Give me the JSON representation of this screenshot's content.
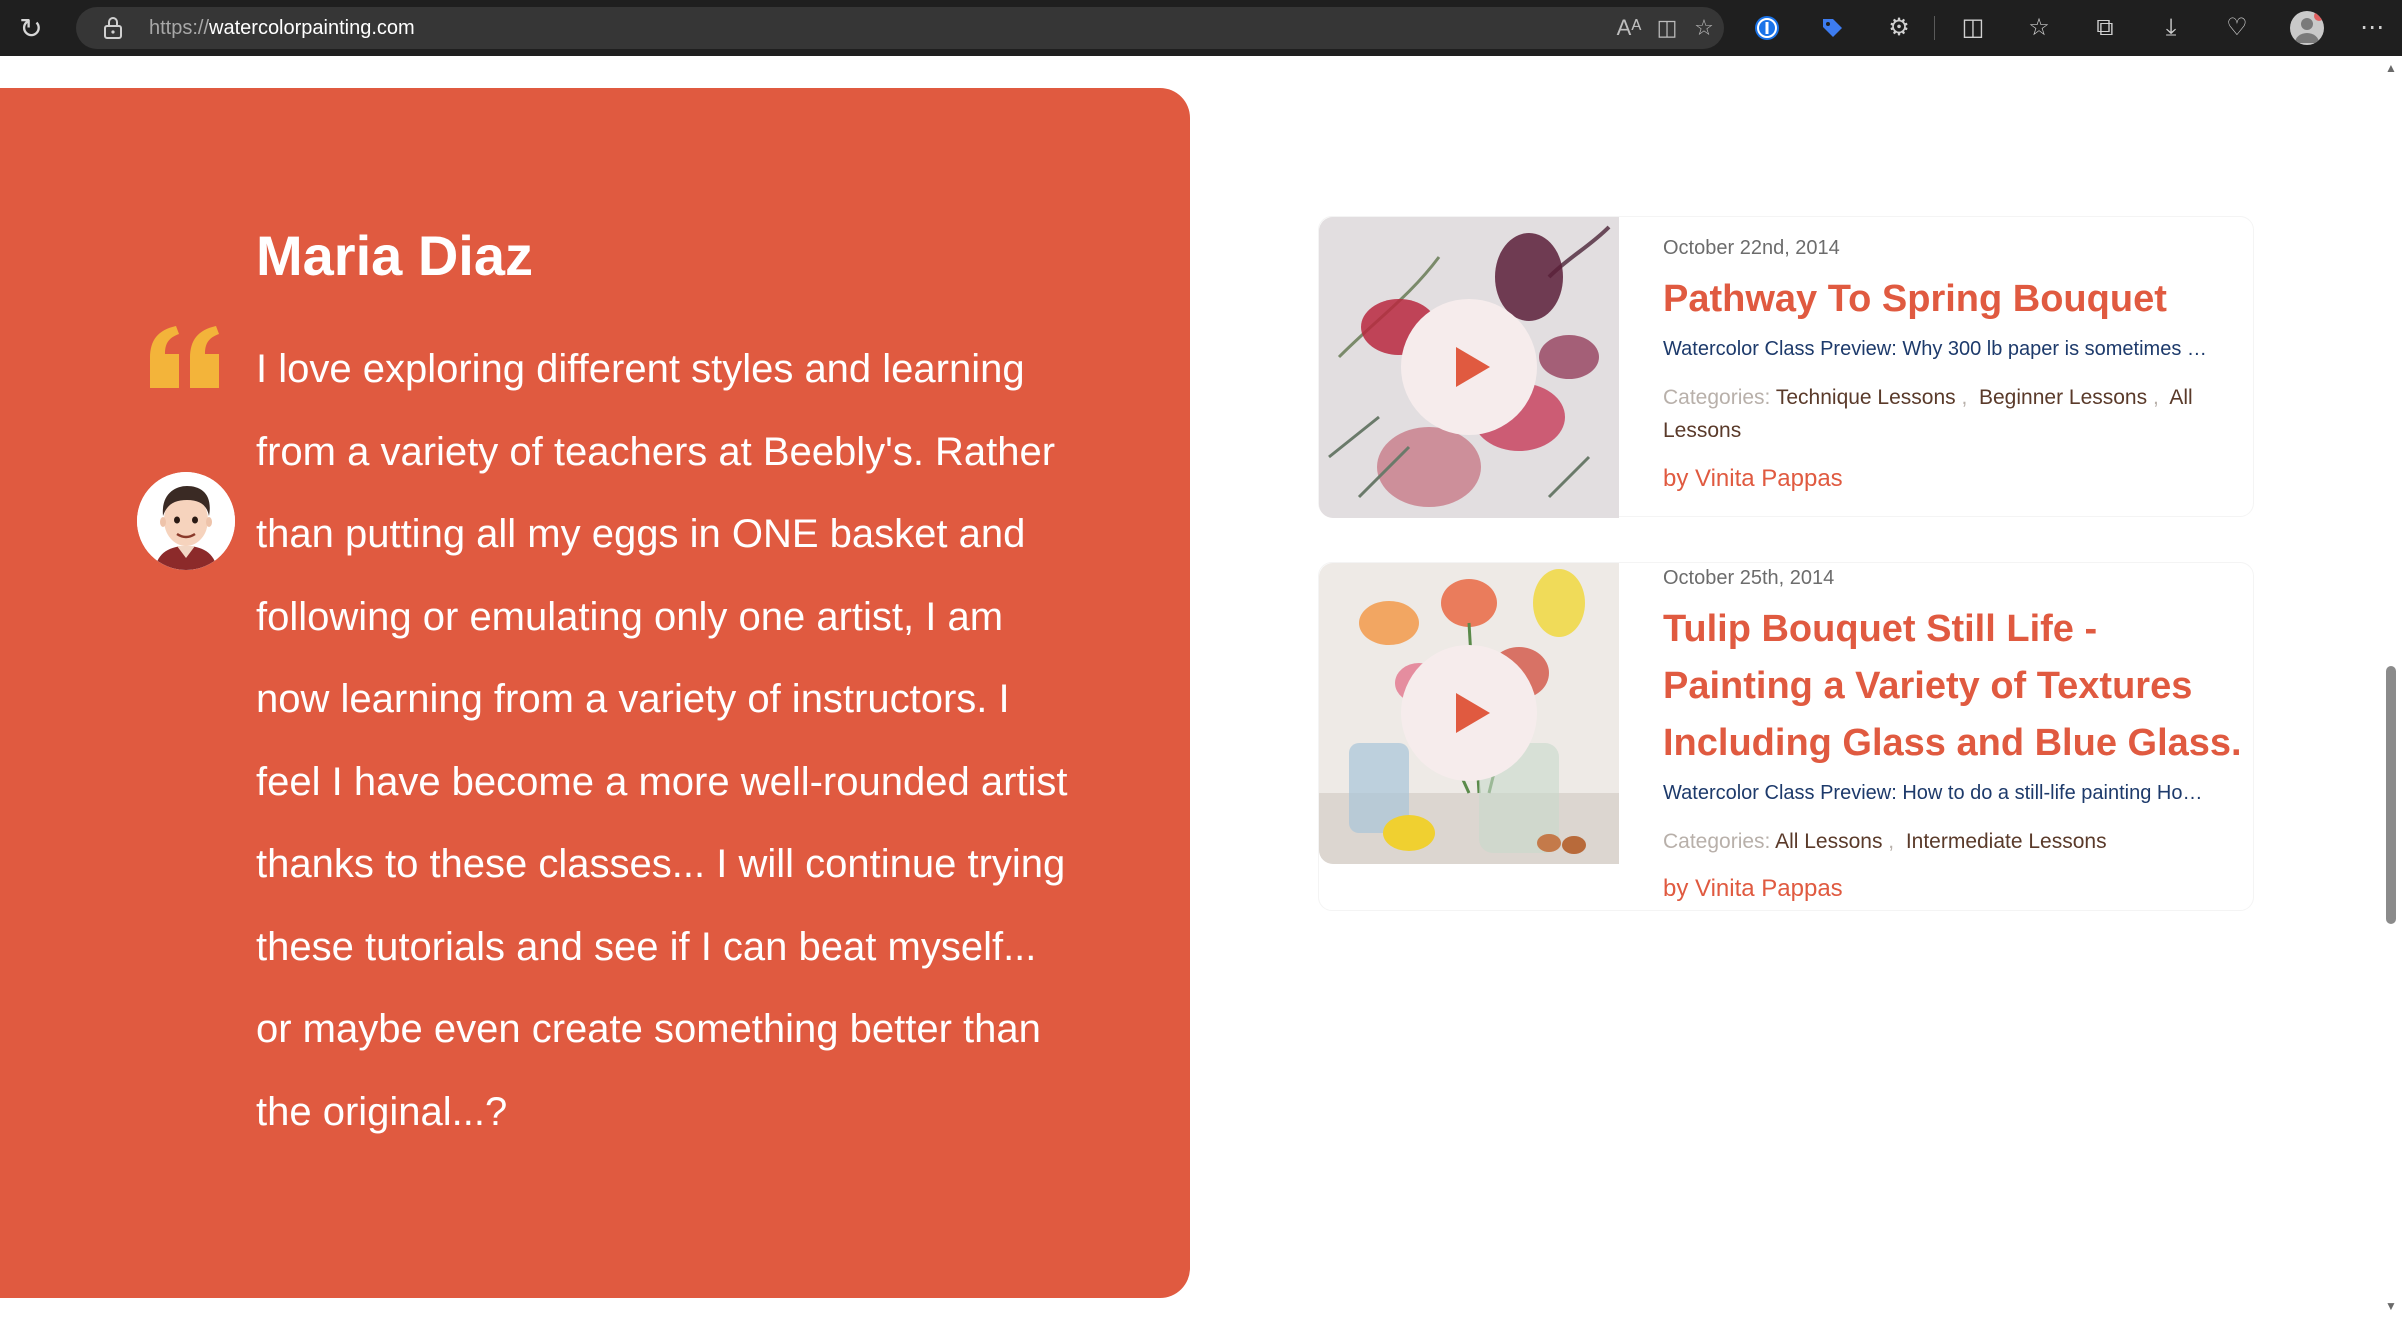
{
  "browser": {
    "url_scheme": "https://",
    "url_host": "watercolorpainting.com"
  },
  "testimonial": {
    "name": "Maria Diaz",
    "text": "I love exploring different styles and learning from a variety of teachers at Beebly's. Rather than putting all my eggs in ONE basket and following or emulating only one artist, I am now learning from a variety of instructors. I feel I have become a more well-rounded artist thanks to these classes... I will continue trying these tutorials and see if I can beat myself... or maybe even create something better than the original...?",
    "accent_color": "#e05a40",
    "quote_color": "#f3b43a"
  },
  "lessons": [
    {
      "date": "October 22nd, 2014",
      "title": "Pathway To Spring Bouquet",
      "excerpt": "Watercolor Class Preview: Why 300 lb paper is sometimes …",
      "categories_label": "Categories:",
      "categories": [
        "Technique Lessons",
        "Beginner Lessons",
        "All Lessons"
      ],
      "author": "by Vinita Pappas"
    },
    {
      "date": "October 25th, 2014",
      "title": "Tulip Bouquet Still Life - Painting a Variety of Textures Including Glass and Blue Glass.",
      "excerpt": "Watercolor Class Preview: How to do a still-life painting Ho…",
      "categories_label": "Categories:",
      "categories": [
        "All Lessons",
        "Intermediate Lessons"
      ],
      "author": "by Vinita Pappas"
    }
  ],
  "icons": {
    "reload": "reload-icon",
    "lock": "lock-icon",
    "play": "play-icon",
    "quote": "quote-icon"
  }
}
